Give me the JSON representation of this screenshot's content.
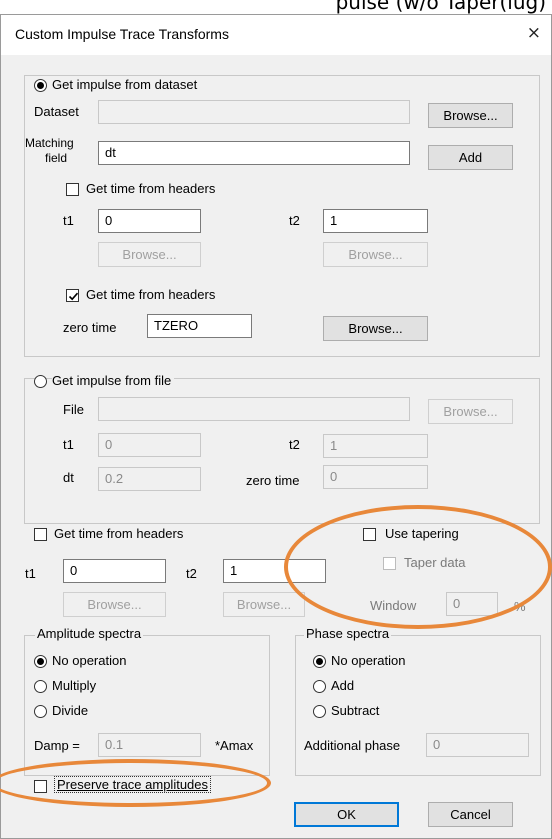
{
  "banner": {
    "text": "pulse (w/o Taper(lug)"
  },
  "window": {
    "title": "Custom Impulse Trace Transforms",
    "close_glyph": "×"
  },
  "dataset_group": {
    "radio_label": "Get impulse from dataset",
    "dataset_label": "Dataset",
    "dataset_value": "",
    "browse_label": "Browse...",
    "matching_label_line1": "Matching",
    "matching_label_line2": "field",
    "matching_value": "dt",
    "add_label": "Add",
    "time_headers_label": "Get time from headers",
    "t1_label": "t1",
    "t1_value": "0",
    "t2_label": "t2",
    "t2_value": "1",
    "browse_t1_label": "Browse...",
    "browse_t2_label": "Browse...",
    "time_headers2_label": "Get time from headers",
    "zero_time_label": "zero time",
    "zero_time_value": "TZERO",
    "browse_zero_label": "Browse..."
  },
  "file_group": {
    "radio_label": "Get impulse from file",
    "file_label": "File",
    "file_value": "",
    "browse_label": "Browse...",
    "t1_label": "t1",
    "t1_value": "0",
    "t2_label": "t2",
    "t2_value": "1",
    "dt_label": "dt",
    "dt_value": "0.2",
    "zero_time_label": "zero time",
    "zero_time_value": "0"
  },
  "time_section": {
    "headers_label": "Get time from headers",
    "t1_label": "t1",
    "t1_value": "0",
    "t2_label": "t2",
    "t2_value": "1",
    "browse1_label": "Browse...",
    "browse2_label": "Browse..."
  },
  "tapering": {
    "use_label": "Use tapering",
    "taper_data_label": "Taper data",
    "window_label": "Window",
    "window_value": "0",
    "percent": "%"
  },
  "amplitude": {
    "title": "Amplitude spectra",
    "options": [
      "No operation",
      "Multiply",
      "Divide"
    ],
    "damp_label": "Damp =",
    "damp_value": "0.1",
    "amax_label": "*Amax"
  },
  "phase": {
    "title": "Phase spectra",
    "options": [
      "No operation",
      "Add",
      "Subtract"
    ],
    "additional_label": "Additional phase",
    "additional_value": "0"
  },
  "preserve_label": "Preserve trace amplitudes",
  "buttons": {
    "ok": "OK",
    "cancel": "Cancel"
  },
  "highlight_color": "#e8883a",
  "accent_color": "#0078d7"
}
